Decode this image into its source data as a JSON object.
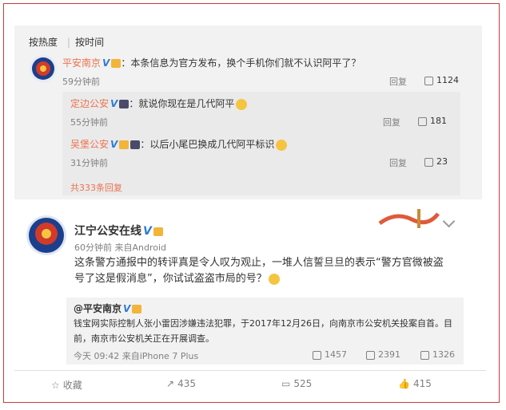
{
  "sort_tabs": {
    "hot": "按热度",
    "time": "按时间"
  },
  "comments": [
    {
      "author": "平安南京",
      "text": "：本条信息为官方发布，换个手机你们就不认识阿平了？",
      "time": "59分钟前",
      "reply": "回复",
      "likes": "1124"
    }
  ],
  "replies": [
    {
      "author": "定边公安",
      "text": "：就说你现在是几代阿平",
      "time": "55分钟前",
      "reply": "回复",
      "likes": "181"
    },
    {
      "author": "吴堡公安",
      "text": "：以后小尾巴换成几代阿平标识",
      "time": "31分钟前",
      "reply": "回复",
      "likes": "23"
    }
  ],
  "more_replies": "共333条回复",
  "post": {
    "author": "江宁公安在线",
    "meta": "60分钟前 来自Android",
    "text": "这条警方通报中的转评真是令人叹为观止，一堆人信誓旦旦的表示“警方官微被盗号了这是假消息”，你试试盗盗市局的号？",
    "repost": {
      "author": "@平安南京",
      "text": "钱宝网实际控制人张小雷因涉嫌违法犯罪，于2017年12月26日，向南京市公安机关投案自首。目前，南京市公安机关正在开展调查。",
      "meta": "今天 09:42 来自iPhone 7 Plus",
      "reposts": "1457",
      "comments": "2391",
      "likes": "1326"
    }
  },
  "bottom": {
    "favorite": "收藏",
    "repost": "435",
    "comment": "525",
    "like": "415"
  },
  "colors": {
    "accent": "#eb7350",
    "verified": "#2b7cd3",
    "frame": "#c53b3b"
  }
}
